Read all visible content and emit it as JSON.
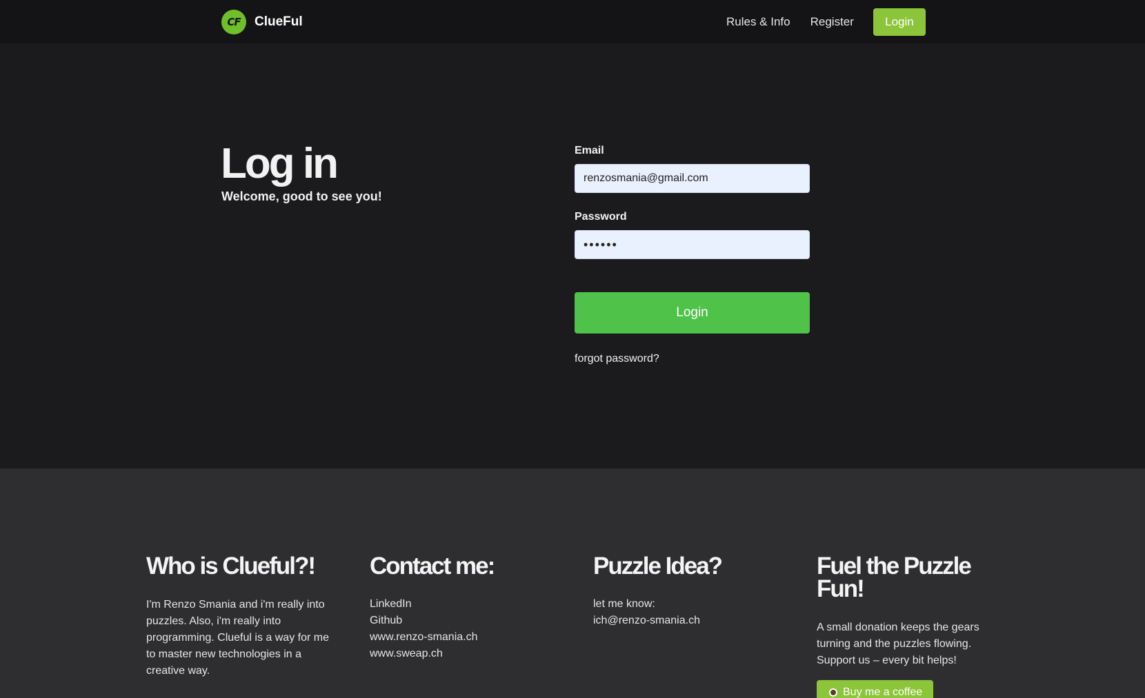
{
  "nav": {
    "logo_text": "CF",
    "brand": "ClueFul",
    "links": [
      "Rules & Info",
      "Register"
    ],
    "login_label": "Login",
    "accent": "#8cc43a"
  },
  "hero": {
    "title": "Log in",
    "subtitle": "Welcome, good to see you!"
  },
  "form": {
    "email_label": "Email",
    "email_value": "renzosmania@gmail.com",
    "password_label": "Password",
    "password_value": "••••••",
    "submit_label": "Login",
    "submit_color": "#4fc24a",
    "forgot_label": "forgot password?"
  },
  "footer": {
    "about": {
      "title": "Who is Clueful?!",
      "text": "I'm Renzo Smania and i'm really into puzzles. Also, i'm really into programming. Clueful is a way for me to master new technologies in a creative way."
    },
    "contact": {
      "title": "Contact me:",
      "links": [
        "LinkedIn",
        "Github",
        "www.renzo-smania.ch",
        "www.sweap.ch"
      ]
    },
    "idea": {
      "title": "Puzzle Idea?",
      "line1": "let me know:",
      "email": "ich@renzo-smania.ch"
    },
    "donate": {
      "title": "Fuel the Puzzle Fun!",
      "text": "A small donation keeps the gears turning and the puzzles flowing. Support us – every bit helps!",
      "button_label": "Buy me a coffee",
      "button_icon": "coffee-cup-icon"
    }
  }
}
